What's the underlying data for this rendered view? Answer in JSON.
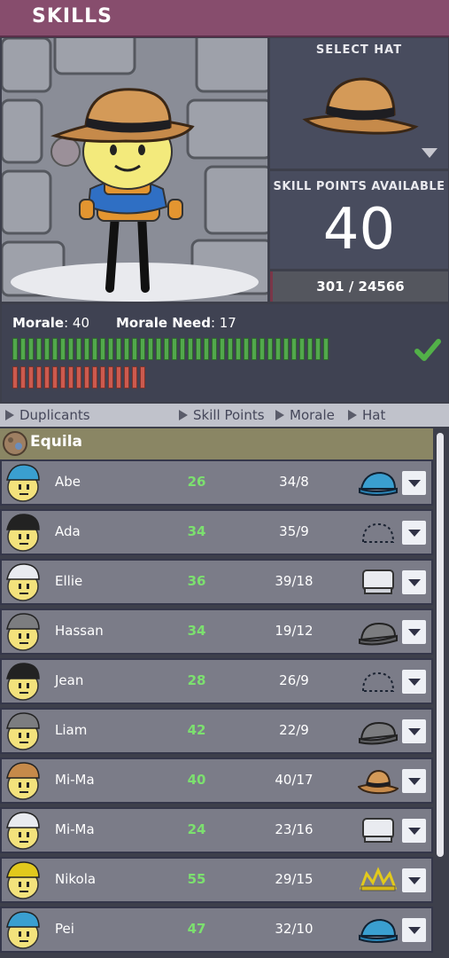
{
  "header": {
    "title": "SKILLS"
  },
  "hat_select": {
    "label": "SELECT HAT",
    "current_hat_icon": "cowboy-hat-icon"
  },
  "skill_points": {
    "label": "SKILL POINTS AVAILABLE",
    "value": "40",
    "xp_text": "301 / 24566"
  },
  "morale": {
    "morale_label": "Morale",
    "morale_value": "40",
    "need_label": "Morale Need",
    "need_value": "17",
    "green_segments": 40,
    "red_segments": 17,
    "colors": {
      "green": "#52a84c",
      "red": "#cc5a4e",
      "check": "#52b048"
    }
  },
  "columns": {
    "duplicants": "Duplicants",
    "skill_points": "Skill Points",
    "morale": "Morale",
    "hat": "Hat"
  },
  "group": {
    "name": "Equila",
    "icon": "planetoid-icon"
  },
  "duplicants": [
    {
      "name": "Abe",
      "skill_points": "26",
      "morale": "34/8",
      "hat": "cap-blue-icon"
    },
    {
      "name": "Ada",
      "skill_points": "34",
      "morale": "35/9",
      "hat": "no-hat-icon"
    },
    {
      "name": "Ellie",
      "skill_points": "36",
      "morale": "39/18",
      "hat": "chef-hat-icon"
    },
    {
      "name": "Hassan",
      "skill_points": "34",
      "morale": "19/12",
      "hat": "cap-gray-icon"
    },
    {
      "name": "Jean",
      "skill_points": "28",
      "morale": "26/9",
      "hat": "no-hat-icon"
    },
    {
      "name": "Liam",
      "skill_points": "42",
      "morale": "22/9",
      "hat": "cap-gray-icon"
    },
    {
      "name": "Mi-Ma",
      "skill_points": "40",
      "morale": "40/17",
      "hat": "cowboy-hat-icon"
    },
    {
      "name": "Mi-Ma",
      "skill_points": "24",
      "morale": "23/16",
      "hat": "chef-hat-icon"
    },
    {
      "name": "Nikola",
      "skill_points": "55",
      "morale": "29/15",
      "hat": "tiara-icon"
    },
    {
      "name": "Pei",
      "skill_points": "47",
      "morale": "32/10",
      "hat": "cap-blue-icon"
    }
  ]
}
